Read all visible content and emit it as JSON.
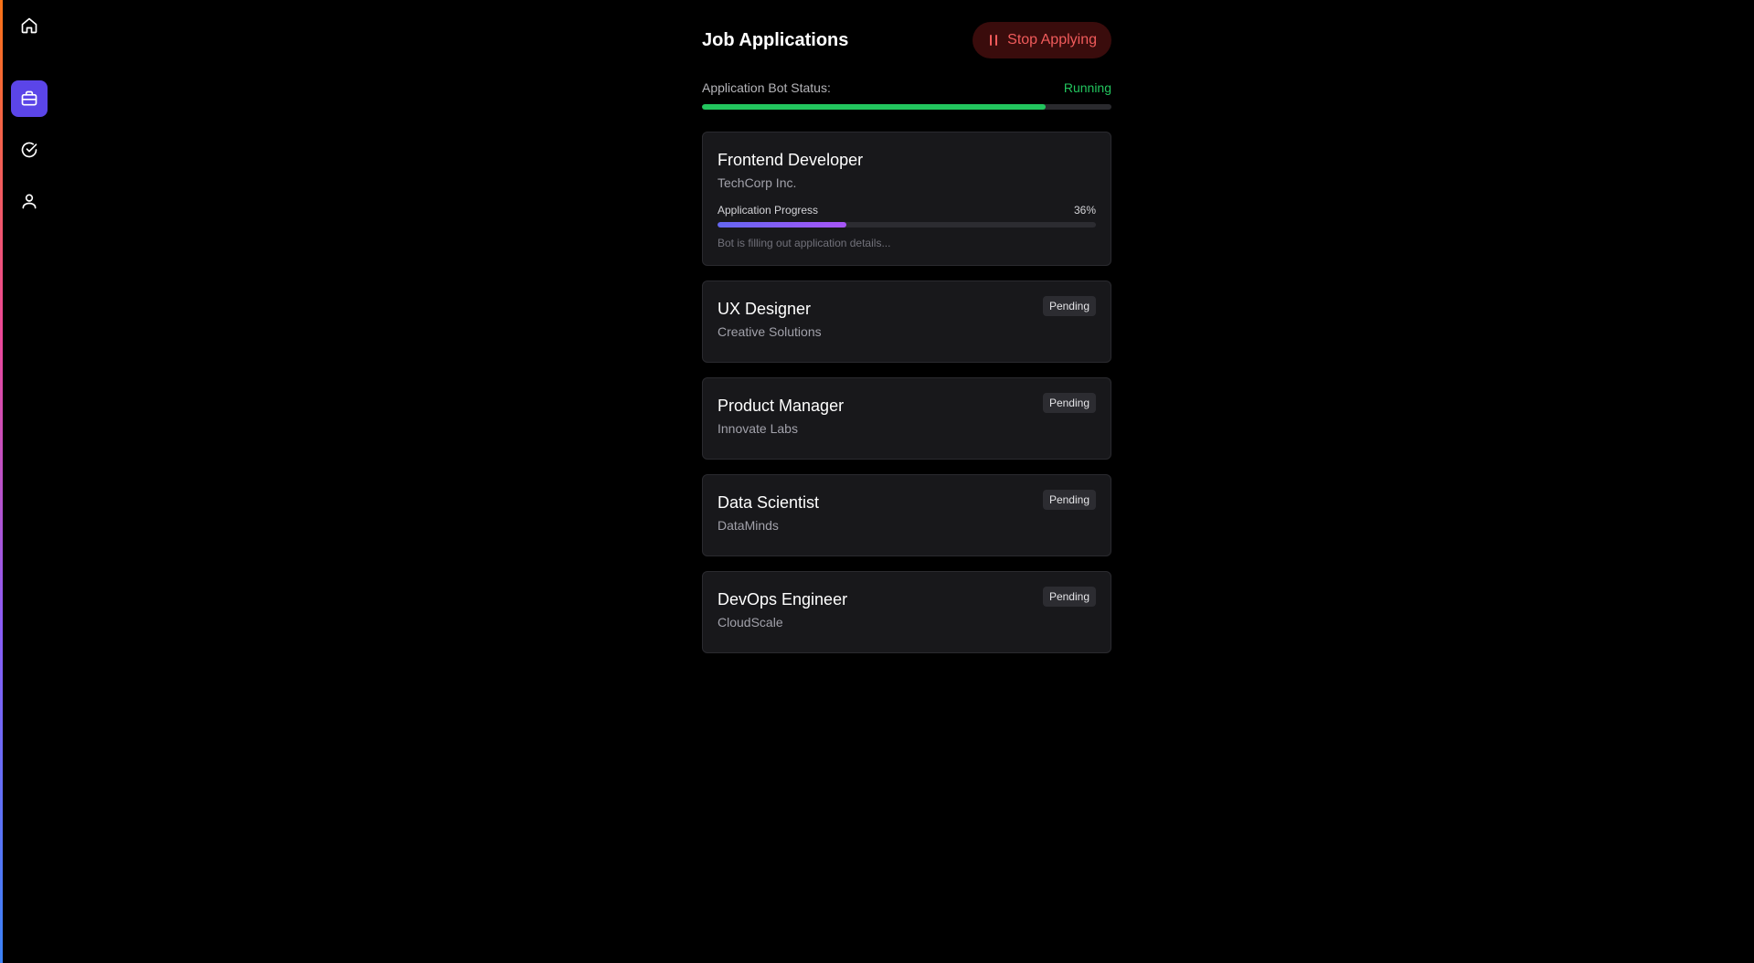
{
  "sidebar": {
    "items": [
      {
        "label": "Home",
        "icon": "home-icon",
        "active": false
      },
      {
        "label": "Jobs",
        "icon": "briefcase-icon",
        "active": true
      },
      {
        "label": "Completed",
        "icon": "check-circle-icon",
        "active": false
      },
      {
        "label": "Profile",
        "icon": "user-icon",
        "active": false
      }
    ]
  },
  "header": {
    "title": "Job Applications",
    "stop_button_label": "Stop Applying"
  },
  "bot": {
    "status_label": "Application Bot Status:",
    "status_value": "Running",
    "progress_fraction": 0.84
  },
  "jobs": [
    {
      "title": "Frontend Developer",
      "company": "TechCorp Inc.",
      "progress_label": "Application Progress",
      "progress_percent_text": "36%",
      "progress_fraction": 0.34,
      "note": "Bot is filling out application details..."
    },
    {
      "title": "UX Designer",
      "company": "Creative Solutions",
      "status": "Pending"
    },
    {
      "title": "Product Manager",
      "company": "Innovate Labs",
      "status": "Pending"
    },
    {
      "title": "Data Scientist",
      "company": "DataMinds",
      "status": "Pending"
    },
    {
      "title": "DevOps Engineer",
      "company": "CloudScale",
      "status": "Pending"
    }
  ],
  "colors": {
    "accent": "#5b45e8",
    "running": "#22c55e",
    "stop": "#f15b5b"
  }
}
